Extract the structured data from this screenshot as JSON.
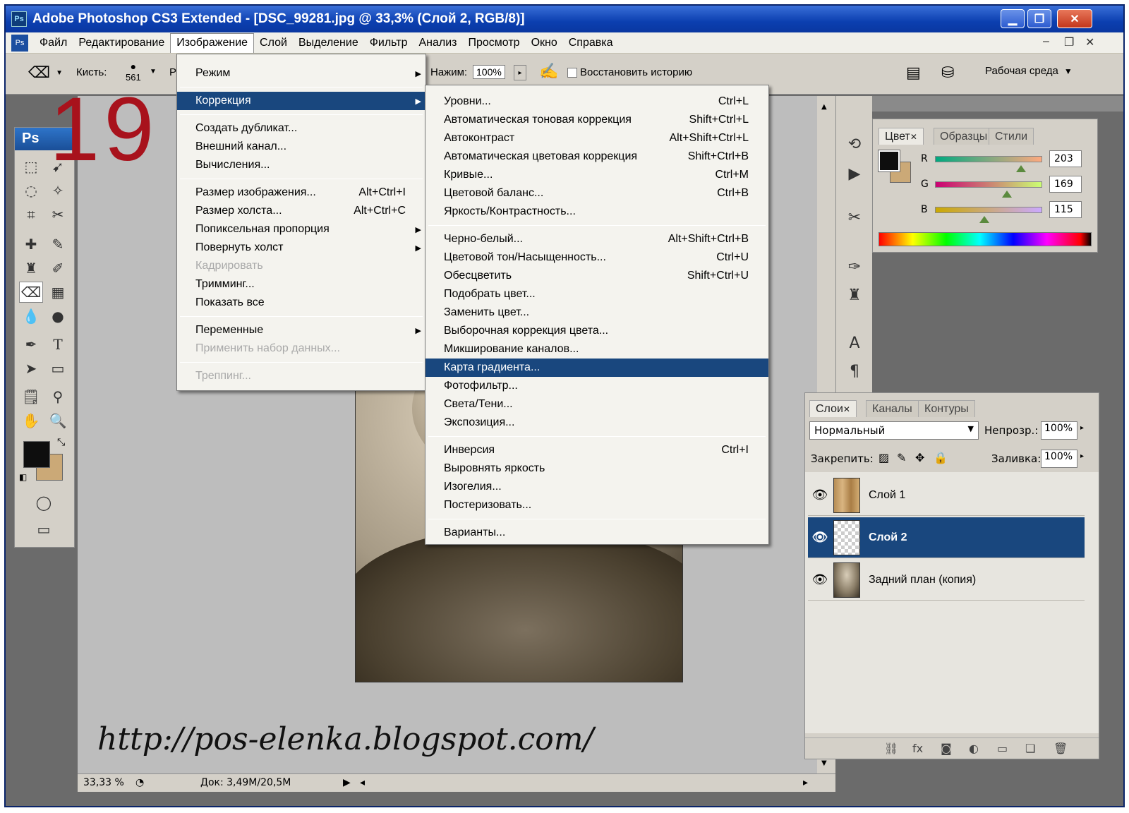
{
  "window": {
    "title": "Adobe Photoshop CS3 Extended - [DSC_99281.jpg @ 33,3% (Слой 2, RGB/8)]",
    "app_badge": "Ps",
    "controls": {
      "minimize": "▁",
      "restore": "❐",
      "close": "✕"
    }
  },
  "menubar": {
    "items": [
      "Файл",
      "Редактирование",
      "Изображение",
      "Слой",
      "Выделение",
      "Фильтр",
      "Анализ",
      "Просмотр",
      "Окно",
      "Справка"
    ],
    "active_index": 2,
    "doc_controls": [
      "–",
      "❐",
      "✕"
    ]
  },
  "options_bar": {
    "brush_label": "Кисть:",
    "brush_size": "561",
    "truncated_label": "Р",
    "pressure_label": "Нажим:",
    "pressure_value": "100%",
    "restore_history_label": "Восстановить историю",
    "workspace_label": "Рабочая среда"
  },
  "overlay_number": "19",
  "url_watermark": "http://pos-elenka.blogspot.com/",
  "image_menu": {
    "items": [
      {
        "label": "Режим",
        "shortcut": "",
        "submenu": true,
        "disabled": false
      },
      {
        "separator": true
      },
      {
        "label": "Коррекция",
        "shortcut": "",
        "submenu": true,
        "disabled": false,
        "highlighted": true
      },
      {
        "separator": true
      },
      {
        "label": "Создать дубликат...",
        "shortcut": "",
        "submenu": false,
        "disabled": false
      },
      {
        "label": "Внешний канал...",
        "shortcut": "",
        "submenu": false,
        "disabled": false
      },
      {
        "label": "Вычисления...",
        "shortcut": "",
        "submenu": false,
        "disabled": false
      },
      {
        "separator": true
      },
      {
        "label": "Размер изображения...",
        "shortcut": "Alt+Ctrl+I",
        "submenu": false,
        "disabled": false
      },
      {
        "label": "Размер холста...",
        "shortcut": "Alt+Ctrl+C",
        "submenu": false,
        "disabled": false
      },
      {
        "label": "Попиксельная пропорция",
        "shortcut": "",
        "submenu": true,
        "disabled": false
      },
      {
        "label": "Повернуть холст",
        "shortcut": "",
        "submenu": true,
        "disabled": false
      },
      {
        "label": "Кадрировать",
        "shortcut": "",
        "submenu": false,
        "disabled": true
      },
      {
        "label": "Тримминг...",
        "shortcut": "",
        "submenu": false,
        "disabled": false
      },
      {
        "label": "Показать все",
        "shortcut": "",
        "submenu": false,
        "disabled": false
      },
      {
        "separator": true
      },
      {
        "label": "Переменные",
        "shortcut": "",
        "submenu": true,
        "disabled": false
      },
      {
        "label": "Применить набор данных...",
        "shortcut": "",
        "submenu": false,
        "disabled": true
      },
      {
        "separator": true
      },
      {
        "label": "Треппинг...",
        "shortcut": "",
        "submenu": false,
        "disabled": true
      }
    ]
  },
  "adjust_menu": {
    "items": [
      {
        "label": "Уровни...",
        "shortcut": "Ctrl+L"
      },
      {
        "label": "Автоматическая тоновая коррекция",
        "shortcut": "Shift+Ctrl+L"
      },
      {
        "label": "Автоконтраст",
        "shortcut": "Alt+Shift+Ctrl+L"
      },
      {
        "label": "Автоматическая цветовая коррекция",
        "shortcut": "Shift+Ctrl+B"
      },
      {
        "label": "Кривые...",
        "shortcut": "Ctrl+M"
      },
      {
        "label": "Цветовой баланс...",
        "shortcut": "Ctrl+B"
      },
      {
        "label": "Яркость/Контрастность...",
        "shortcut": ""
      },
      {
        "separator": true
      },
      {
        "label": "Черно-белый...",
        "shortcut": "Alt+Shift+Ctrl+B"
      },
      {
        "label": "Цветовой тон/Насыщенность...",
        "shortcut": "Ctrl+U"
      },
      {
        "label": "Обесцветить",
        "shortcut": "Shift+Ctrl+U"
      },
      {
        "label": "Подобрать цвет...",
        "shortcut": ""
      },
      {
        "label": "Заменить цвет...",
        "shortcut": ""
      },
      {
        "label": "Выборочная коррекция цвета...",
        "shortcut": ""
      },
      {
        "label": "Микширование каналов...",
        "shortcut": ""
      },
      {
        "label": "Карта градиента...",
        "shortcut": "",
        "highlighted": true
      },
      {
        "label": "Фотофильтр...",
        "shortcut": ""
      },
      {
        "label": "Света/Тени...",
        "shortcut": ""
      },
      {
        "label": "Экспозиция...",
        "shortcut": ""
      },
      {
        "separator": true
      },
      {
        "label": "Инверсия",
        "shortcut": "Ctrl+I"
      },
      {
        "label": "Выровнять яркость",
        "shortcut": ""
      },
      {
        "label": "Изогелия...",
        "shortcut": ""
      },
      {
        "label": "Постеризовать...",
        "shortcut": ""
      },
      {
        "separator": true
      },
      {
        "label": "Варианты...",
        "shortcut": ""
      }
    ]
  },
  "color_panel": {
    "tabs": [
      "Цвет",
      "Образцы",
      "Стили"
    ],
    "active_tab": 0,
    "channels": [
      {
        "name": "R",
        "value": "203",
        "fraction": 0.796
      },
      {
        "name": "G",
        "value": "169",
        "fraction": 0.663
      },
      {
        "name": "B",
        "value": "115",
        "fraction": 0.451
      }
    ],
    "foreground_color": "#0e0e0e",
    "background_color": "#cba977"
  },
  "layers_panel": {
    "tabs": [
      "Слои",
      "Каналы",
      "Контуры"
    ],
    "active_tab": 0,
    "blend_mode": "Нормальный",
    "opacity_label": "Непрозр.:",
    "opacity_value": "100%",
    "lock_label": "Закрепить:",
    "fill_label": "Заливка:",
    "fill_value": "100%",
    "layers": [
      {
        "name": "Слой 1",
        "selected": false,
        "thumb": "wood"
      },
      {
        "name": "Слой 2",
        "selected": true,
        "thumb": "transparent"
      },
      {
        "name": "Задний план (копия)",
        "selected": false,
        "thumb": "portrait"
      }
    ],
    "footer_icons": [
      "link-icon",
      "fx-icon",
      "mask-icon",
      "adjustment-icon",
      "folder-icon",
      "new-layer-icon",
      "trash-icon"
    ],
    "footer_glyphs": [
      "⛓",
      "fx",
      "◙",
      "◐",
      "▭",
      "❏",
      "🗑"
    ]
  },
  "status_bar": {
    "zoom": "33,33 %",
    "doc_info": "Док: 3,49M/20,5M"
  },
  "colors": {
    "menu_highlight": "#19477e",
    "title_blue": "#0b3fb0",
    "overlay_red": "#a8121c"
  }
}
